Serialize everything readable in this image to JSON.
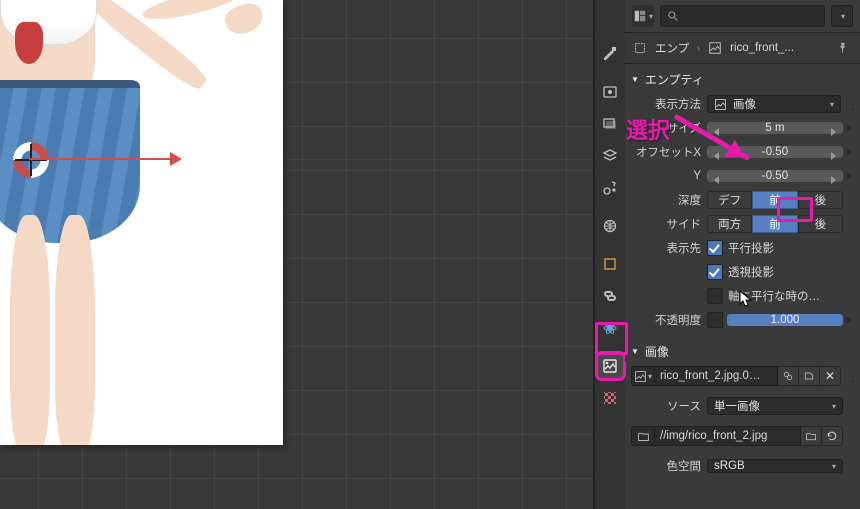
{
  "header": {
    "search_placeholder": ""
  },
  "breadcrumb": {
    "item1": "エンプ",
    "item2": "rico_front_..."
  },
  "panel": {
    "empty_title": "エンプティ",
    "image_title": "画像",
    "display_method_label": "表示方法",
    "display_method_value": "画像",
    "size_label": "サイズ",
    "size_value": "5 m",
    "offsetx_label": "オフセットX",
    "offsetx_value": "-0.50",
    "offsety_label": "Y",
    "offsety_value": "-0.50",
    "depth_label": "深度",
    "depth_options": [
      "デフ",
      "前",
      "後"
    ],
    "depth_selected": 1,
    "side_label": "サイド",
    "side_options": [
      "両方",
      "前",
      "後"
    ],
    "side_selected": 1,
    "displayto_label": "表示先",
    "perspective1": "平行投影",
    "perspective2": "透視投影",
    "axis_parallel": "軸に平行な時の…",
    "opacity_label": "不透明度",
    "opacity_value": "1.000"
  },
  "image": {
    "datablock": "rico_front_2.jpg.0…",
    "source_label": "ソース",
    "source_value": "単一画像",
    "filepath": "//img/rico_front_2.jpg",
    "colorspace_label": "色空間",
    "colorspace_value": "sRGB"
  },
  "annotation": {
    "label": "選択"
  }
}
